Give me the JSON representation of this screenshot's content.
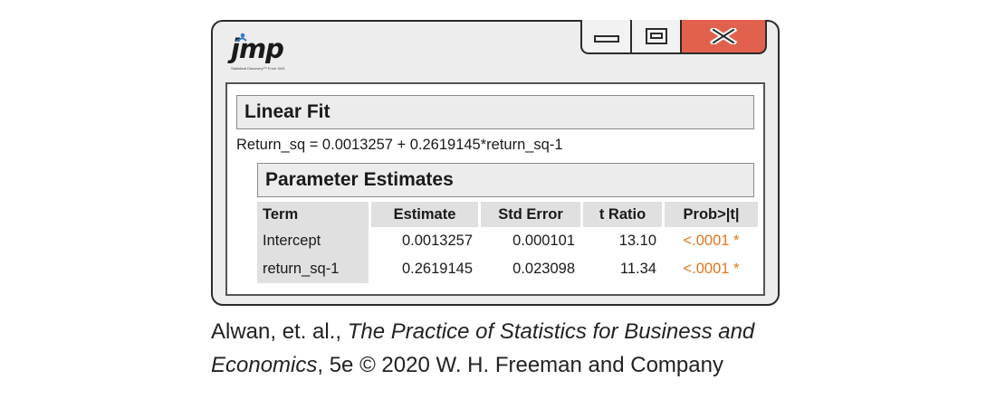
{
  "app": {
    "logo_text": "jmp",
    "logo_tagline": "Statistical Discovery™ From SAS."
  },
  "window_controls": [
    "minimize",
    "restore",
    "close"
  ],
  "linear_fit": {
    "title": "Linear Fit",
    "equation": "Return_sq = 0.0013257 + 0.2619145*return_sq-1"
  },
  "parameter_estimates": {
    "title": "Parameter Estimates",
    "columns": [
      "Term",
      "Estimate",
      "Std Error",
      "t Ratio",
      "Prob>|t|"
    ],
    "rows": [
      {
        "term": "Intercept",
        "estimate": "0.0013257",
        "std_error": "0.000101",
        "t_ratio": "13.10",
        "prob": "<.0001 *"
      },
      {
        "term": "return_sq-1",
        "estimate": "0.2619145",
        "std_error": "0.023098",
        "t_ratio": "11.34",
        "prob": "<.0001 *"
      }
    ]
  },
  "colors": {
    "close_button": "#e2614e",
    "significance": "#e0751d",
    "header_fill": "#ececec"
  },
  "caption": {
    "authors": "Alwan, et. al., ",
    "book_title_1": "The Practice of Statistics for Business and",
    "book_title_2": "Economics",
    "edition_rest": ", 5e © 2020 W. H. Freeman and Company"
  }
}
